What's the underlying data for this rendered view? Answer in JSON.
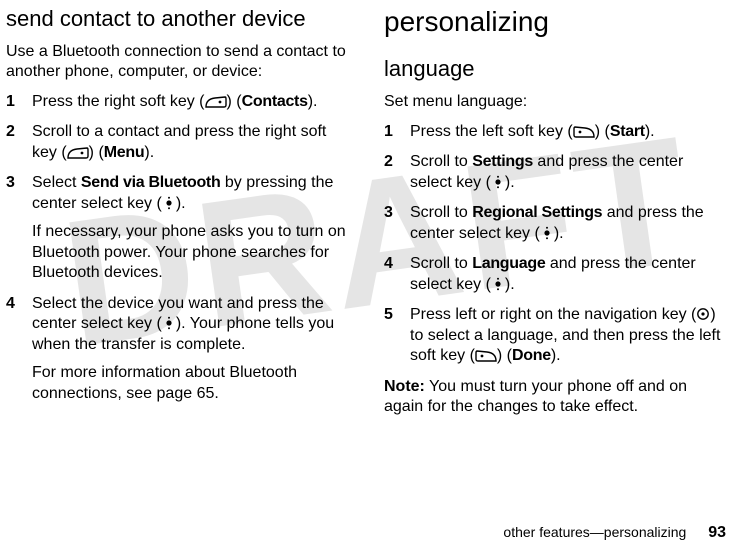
{
  "watermark": "DRAFT",
  "left": {
    "heading": "send contact to another device",
    "intro": "Use a Bluetooth connection to send a contact to another phone, computer, or device:",
    "steps": {
      "s1a": "Press the right soft key (",
      "s1b": ") (",
      "s1c": "Contacts",
      "s1d": ").",
      "s2a": "Scroll to a contact and press the right soft key (",
      "s2b": ") (",
      "s2c": "Menu",
      "s2d": ").",
      "s3a": "Select ",
      "s3b": "Send via Bluetooth",
      "s3c": " by pressing the center select key (",
      "s3d": ").",
      "s3sub": "If necessary, your phone asks you to turn on Bluetooth power. Your phone searches for Bluetooth devices.",
      "s4a": "Select the device you want and press the center select key (",
      "s4b": "). Your phone tells you when the transfer is complete.",
      "s4sub": "For more information about Bluetooth connections, see page 65."
    }
  },
  "right": {
    "top_heading": "personalizing",
    "heading": "language",
    "intro": "Set menu language:",
    "steps": {
      "s1a": "Press the left soft key (",
      "s1b": ") (",
      "s1c": "Start",
      "s1d": ").",
      "s2a": "Scroll to ",
      "s2b": "Settings",
      "s2c": " and press the center select key (",
      "s2d": ").",
      "s3a": "Scroll to ",
      "s3b": "Regional Settings",
      "s3c": " and press the center select key (",
      "s3d": ").",
      "s4a": "Scroll to ",
      "s4b": "Language",
      "s4c": " and press the center select key (",
      "s4d": ").",
      "s5a": "Press left or right on the navigation key (",
      "s5b": ") to select a language, and then press the left soft key (",
      "s5c": ") (",
      "s5d": "Done",
      "s5e": ")."
    },
    "note_label": "Note:",
    "note_body": " You must turn your phone off and on again for the changes to take effect."
  },
  "footer": {
    "text": "other features—personalizing",
    "page": "93"
  }
}
